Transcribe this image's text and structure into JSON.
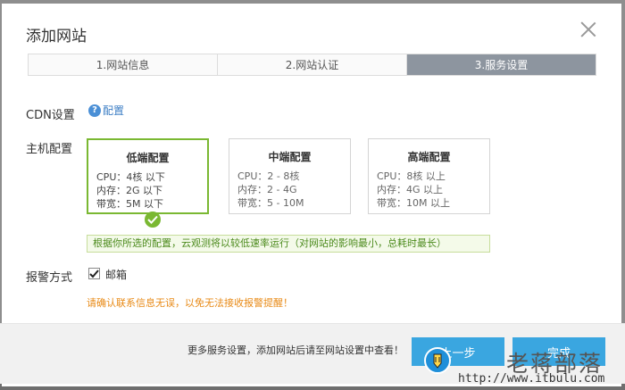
{
  "dialog": {
    "title": "添加网站",
    "steps": [
      {
        "label": "1.网站信息",
        "active": false
      },
      {
        "label": "2.网站认证",
        "active": false
      },
      {
        "label": "3.服务设置",
        "active": true
      }
    ]
  },
  "cdn": {
    "label": "CDN设置",
    "link_label": "配置",
    "help_icon": "question-circle-icon",
    "help_glyph": "?"
  },
  "host": {
    "label": "主机配置",
    "options": [
      {
        "title": "低端配置",
        "cpu": "CPU：4核 以下",
        "memory": "内存：2G 以下",
        "bandwidth": "带宽：5M 以下",
        "selected": true
      },
      {
        "title": "中端配置",
        "cpu": "CPU：2 - 8核",
        "memory": "内存：2 - 4G",
        "bandwidth": "带宽：5 - 10M",
        "selected": false
      },
      {
        "title": "高端配置",
        "cpu": "CPU：8核 以上",
        "memory": "内存：4G 以上",
        "bandwidth": "带宽：10M 以上",
        "selected": false
      }
    ],
    "hint": "根据你所选的配置，云观测将以较低速率运行（对网站的影响最小，总耗时最长）"
  },
  "alarm": {
    "label": "报警方式",
    "option_label": "邮箱",
    "checked": true,
    "warning": "请确认联系信息无误，以免无法接收报警提醒！"
  },
  "footer": {
    "note": "更多服务设置，添加网站后请至网站设置中查看！",
    "prev_label": "上一步",
    "done_label": "完成"
  },
  "watermark": {
    "title": "老蒋部落",
    "url": "http://www.itbulu.com"
  },
  "colors": {
    "accent_green": "#7ab832",
    "button_blue": "#3aa6e0",
    "active_step": "#8d959f",
    "warning_orange": "#e88a16"
  }
}
